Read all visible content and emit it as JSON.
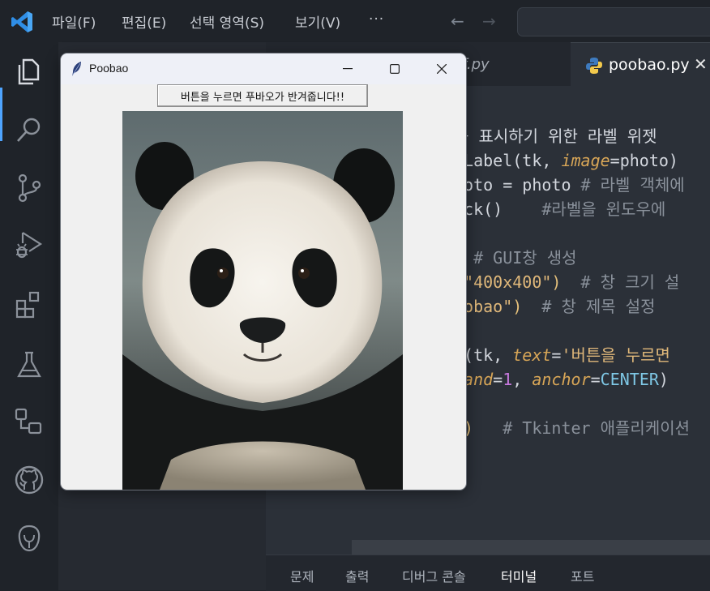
{
  "menu": {
    "items": [
      "파일(F)",
      "편집(E)",
      "선택 영역(S)",
      "보기(V)"
    ],
    "more": "···"
  },
  "activity_bar": {
    "icons": [
      "explorer-icon",
      "search-icon",
      "source-control-icon",
      "run-debug-icon",
      "extensions-icon",
      "testing-icon",
      "remote-explorer-icon",
      "github-icon",
      "database-icon"
    ]
  },
  "tabs": [
    {
      "label": "asdf.py",
      "active": false
    },
    {
      "label": "poobao.py",
      "active": true
    }
  ],
  "code_lines": [
    [
      [
        "c-fn",
        "를 표시하기 위한 라벨 위젯"
      ]
    ],
    [
      [
        "c-fn",
        " Label(tk, "
      ],
      [
        "c-param",
        "image"
      ],
      [
        "c-fn",
        "=photo)"
      ]
    ],
    [
      [
        "c-fn",
        "hoto = photo "
      ],
      [
        "c-cm",
        "# 라벨 객체에"
      ]
    ],
    [
      [
        "c-fn",
        "ack()    "
      ],
      [
        "c-cm",
        "#라벨을 윈도우에"
      ]
    ],
    [
      [
        "c-fn",
        ""
      ]
    ],
    [
      [
        "c-cm",
        "  # GUI창 생성"
      ]
    ],
    [
      [
        "c-paren",
        "("
      ],
      [
        "c-str",
        "\"400x400\""
      ],
      [
        "c-paren",
        ")"
      ],
      [
        "c-cm",
        "  # 창 크기 설"
      ]
    ],
    [
      [
        "c-str",
        "oobao\""
      ],
      [
        "c-paren",
        ")"
      ],
      [
        "c-cm",
        "  # 창 제목 설정"
      ]
    ],
    [
      [
        "c-fn",
        ""
      ]
    ],
    [
      [
        "c-fn",
        "n(tk, "
      ],
      [
        "c-param",
        "text"
      ],
      [
        "c-fn",
        "="
      ],
      [
        "c-str",
        "'버튼을 누르면 "
      ]
    ],
    [
      [
        "c-param",
        "pand"
      ],
      [
        "c-fn",
        "="
      ],
      [
        "c-num",
        "1"
      ],
      [
        "c-fn",
        ", "
      ],
      [
        "c-param",
        "anchor"
      ],
      [
        "c-fn",
        "="
      ],
      [
        "c-const",
        "CENTER"
      ],
      [
        "c-fn",
        ")"
      ]
    ],
    [
      [
        "c-fn",
        ""
      ]
    ],
    [
      [
        "c-paren",
        "()"
      ],
      [
        "c-cm",
        "   # Tkinter 애플리케이션"
      ]
    ]
  ],
  "bottom_panel": {
    "tabs": [
      "문제",
      "출력",
      "디버그 콘솔",
      "터미널",
      "포트"
    ],
    "active": "터미널"
  },
  "tk_window": {
    "title": "Poobao",
    "button_label": "버튼을 누르면 푸바오가 반겨줍니다!!",
    "image_subject": "giant panda portrait"
  }
}
